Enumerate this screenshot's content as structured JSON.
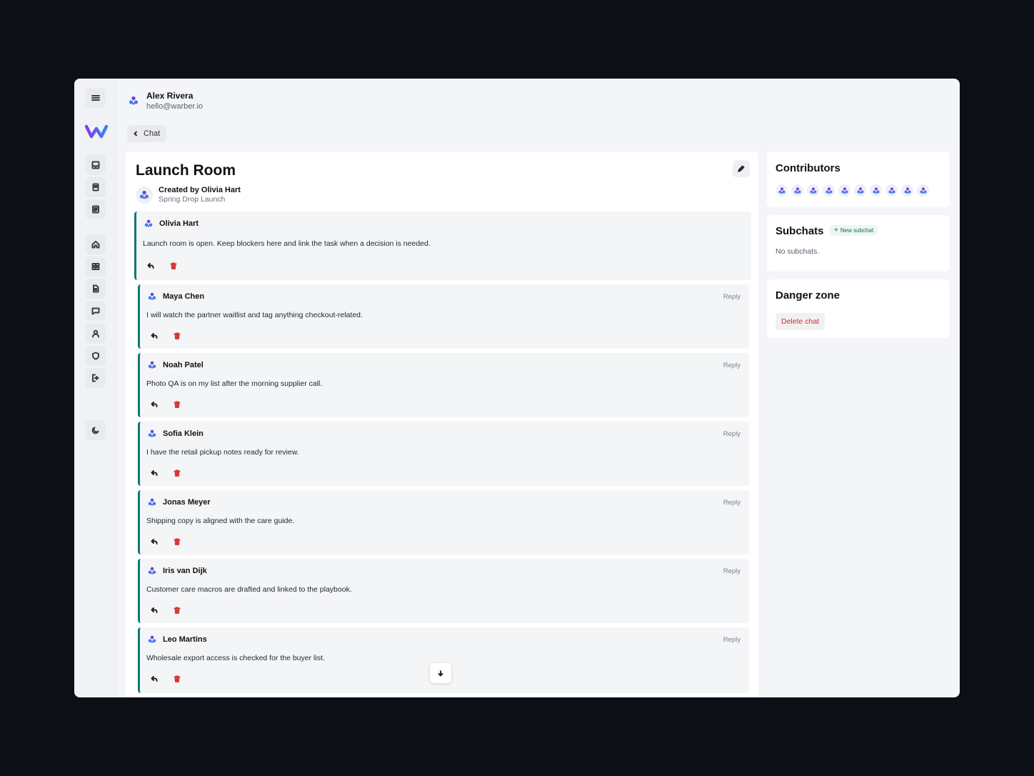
{
  "user": {
    "name": "Alex Rivera",
    "email": "hello@warber.io"
  },
  "nav": {
    "back_label": "Chat"
  },
  "chat": {
    "title": "Launch Room",
    "created_by": "Created by Olivia Hart",
    "project": "Spring Drop Launch"
  },
  "messages": [
    {
      "author": "Olivia Hart",
      "text": "Launch room is open. Keep blockers here and link the task when a decision is needed."
    },
    {
      "author": "Maya Chen",
      "text": "I will watch the partner waitlist and tag anything checkout-related.",
      "reply": "Reply"
    },
    {
      "author": "Noah Patel",
      "text": "Photo QA is on my list after the morning supplier call.",
      "reply": "Reply"
    },
    {
      "author": "Sofia Klein",
      "text": "I have the retail pickup notes ready for review.",
      "reply": "Reply"
    },
    {
      "author": "Jonas Meyer",
      "text": "Shipping copy is aligned with the care guide.",
      "reply": "Reply"
    },
    {
      "author": "Iris van Dijk",
      "text": "Customer care macros are drafted and linked to the playbook.",
      "reply": "Reply"
    },
    {
      "author": "Leo Martins",
      "text": "Wholesale export access is checked for the buyer list.",
      "reply": "Reply"
    }
  ],
  "contributors": {
    "title": "Contributors",
    "count": 10
  },
  "subchats": {
    "title": "Subchats",
    "new_label": "New subchat",
    "empty": "No subchats."
  },
  "danger": {
    "title": "Danger zone",
    "delete_label": "Delete chat"
  },
  "colors": {
    "accent": "#0e7a72",
    "danger": "#d63a3a",
    "brand_start": "#7b3fe4",
    "brand_end": "#3a7bf0"
  }
}
